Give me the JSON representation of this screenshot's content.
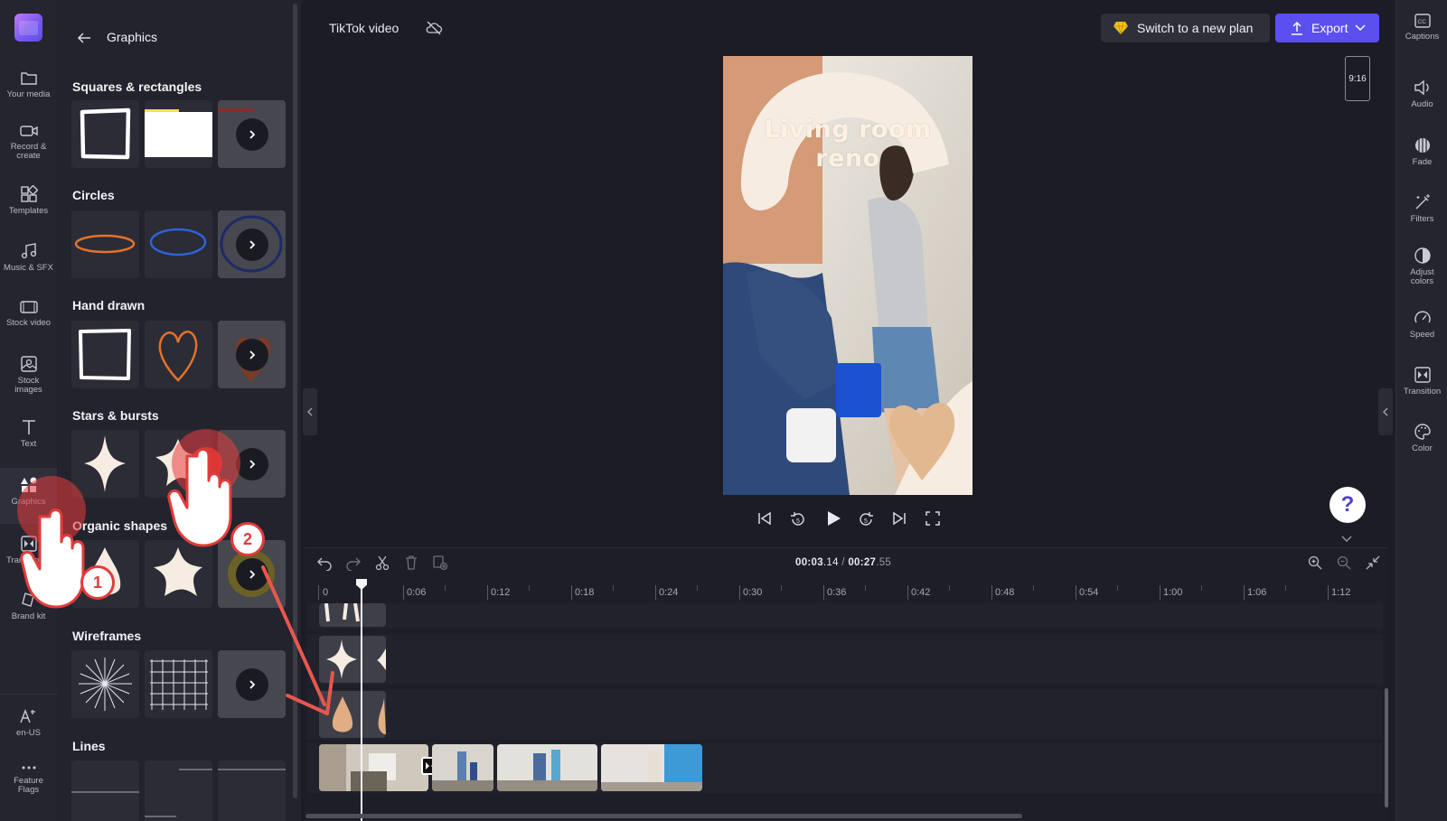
{
  "project": {
    "name": "TikTok video"
  },
  "header": {
    "plan_label": "Switch to a new plan",
    "export_label": "Export"
  },
  "left_rail": {
    "items": [
      {
        "label": "Your media",
        "icon": "folder-icon"
      },
      {
        "label": "Record &",
        "label2": "create",
        "icon": "camera-icon"
      },
      {
        "label": "Templates",
        "icon": "templates-icon"
      },
      {
        "label": "Music & SFX",
        "icon": "music-icon"
      },
      {
        "label": "Stock video",
        "icon": "film-icon"
      },
      {
        "label": "Stock",
        "label2": "images",
        "icon": "image-icon"
      },
      {
        "label": "Text",
        "icon": "text-icon"
      },
      {
        "label": "Graphics",
        "icon": "shapes-icon",
        "active": true
      },
      {
        "label": "Transitions",
        "icon": "transition-icon"
      },
      {
        "label": "Brand kit",
        "icon": "brand-kit-icon"
      },
      {
        "label": "en-US",
        "icon": "language-icon"
      },
      {
        "label": "Feature",
        "label2": "Flags",
        "icon": "more-icon"
      }
    ]
  },
  "panel": {
    "title": "Graphics",
    "sections": [
      {
        "title": "Squares & rectangles"
      },
      {
        "title": "Circles"
      },
      {
        "title": "Hand drawn"
      },
      {
        "title": "Stars & bursts"
      },
      {
        "title": "Organic shapes"
      },
      {
        "title": "Wireframes"
      },
      {
        "title": "Lines"
      }
    ]
  },
  "preview": {
    "title_line1": "Living room",
    "title_line2": "reno",
    "aspect_ratio": "9:16"
  },
  "timeline": {
    "current_time_main": "00:03",
    "current_time_frac": ".14",
    "separator": " / ",
    "total_time_main": "00:27",
    "total_time_frac": ".55",
    "ruler": [
      "0",
      "0:06",
      "0:12",
      "0:18",
      "0:24",
      "0:30",
      "0:36",
      "0:42",
      "0:48",
      "0:54",
      "1:00",
      "1:06",
      "1:12"
    ]
  },
  "right_rail": {
    "items": [
      {
        "label": "Captions",
        "icon": "captions-icon"
      },
      {
        "label": "Audio",
        "icon": "speaker-icon"
      },
      {
        "label": "Fade",
        "icon": "fade-icon"
      },
      {
        "label": "Filters",
        "icon": "magic-wand-icon"
      },
      {
        "label": "Adjust",
        "label2": "colors",
        "icon": "contrast-icon"
      },
      {
        "label": "Speed",
        "icon": "speedometer-icon"
      },
      {
        "label": "Transition",
        "icon": "transition-icon"
      },
      {
        "label": "Color",
        "icon": "palette-icon"
      }
    ]
  },
  "tutorial": {
    "step1": "1",
    "step2": "2"
  },
  "colors": {
    "accent": "#5b4ff0",
    "tap": "#e23b3b",
    "background": "#1b1c25"
  }
}
